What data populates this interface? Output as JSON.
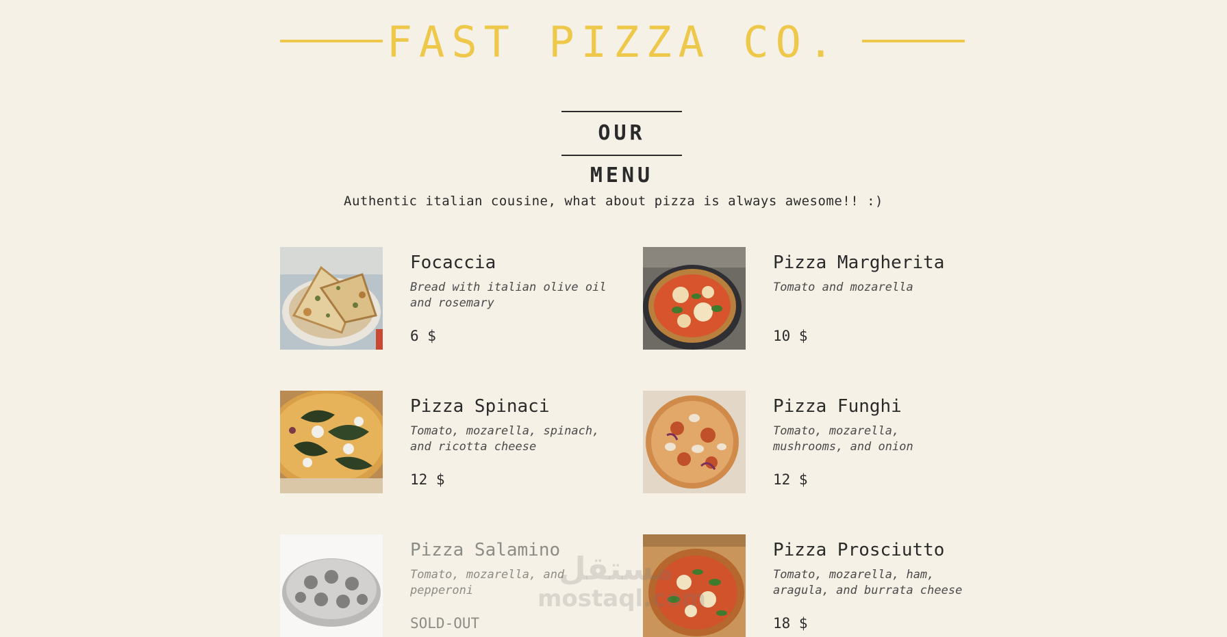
{
  "header": {
    "brand": "FAST PIZZA CO."
  },
  "menu": {
    "heading": "OUR MENU",
    "subtitle": "Authentic italian cousine, what about pizza is always awesome!! :)",
    "items": [
      {
        "name": "Focaccia",
        "description": "Bread with italian olive oil and rosemary",
        "price": "6 $",
        "sold_out": false,
        "photo": "focaccia-photo"
      },
      {
        "name": "Pizza Margherita",
        "description": "Tomato and mozarella",
        "price": "10 $",
        "sold_out": false,
        "photo": "margherita-photo"
      },
      {
        "name": "Pizza Spinaci",
        "description": "Tomato, mozarella, spinach, and ricotta cheese",
        "price": "12 $",
        "sold_out": false,
        "photo": "spinaci-photo"
      },
      {
        "name": "Pizza Funghi",
        "description": "Tomato, mozarella, mushrooms, and onion",
        "price": "12 $",
        "sold_out": false,
        "photo": "funghi-photo"
      },
      {
        "name": "Pizza Salamino",
        "description": "Tomato, mozarella, and pepperoni",
        "price": "SOLD-OUT",
        "sold_out": true,
        "photo": "salamino-photo"
      },
      {
        "name": "Pizza Prosciutto",
        "description": "Tomato, mozarella, ham, aragula, and burrata cheese",
        "price": "18 $",
        "sold_out": false,
        "photo": "prosciutto-photo"
      }
    ]
  },
  "watermark": {
    "arabic": "مستقل",
    "latin": "mostaql.com"
  },
  "colors": {
    "background": "#f6f1e7",
    "brand_yellow": "#edc84b",
    "text": "#2a2a2a",
    "sold_out_text": "#8c8c86"
  }
}
